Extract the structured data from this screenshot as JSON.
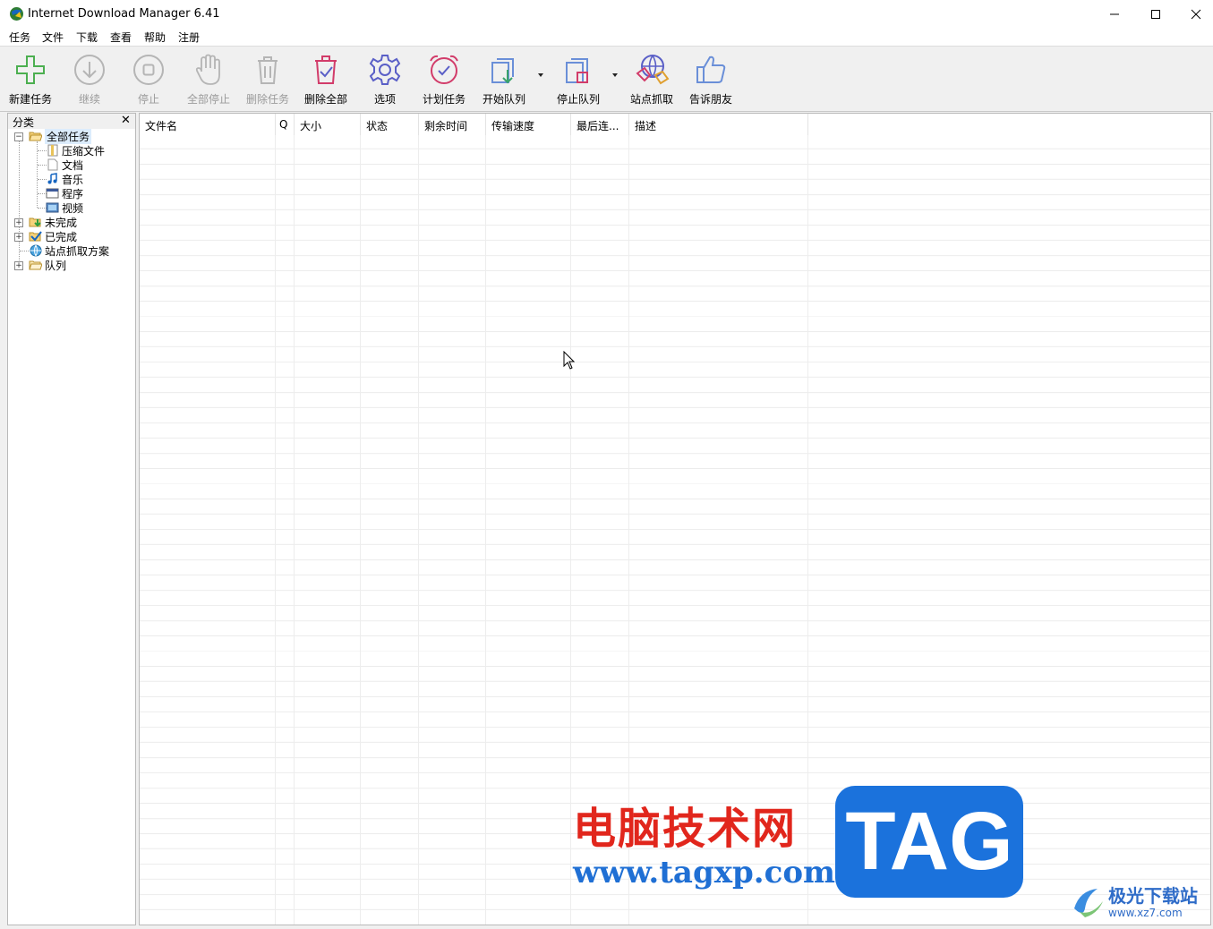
{
  "window": {
    "title": "Internet Download Manager 6.41"
  },
  "menu": [
    "任务",
    "文件",
    "下载",
    "查看",
    "帮助",
    "注册"
  ],
  "toolbar": {
    "new_task": "新建任务",
    "resume": "继续",
    "stop": "停止",
    "stop_all": "全部停止",
    "delete_task": "删除任务",
    "delete_all": "删除全部",
    "options": "选项",
    "scheduler": "计划任务",
    "start_queue": "开始队列",
    "stop_queue": "停止队列",
    "grabber": "站点抓取",
    "tell_friend": "告诉朋友"
  },
  "categories": {
    "title": "分类",
    "close": "✕",
    "all": "全部任务",
    "compressed": "压缩文件",
    "documents": "文档",
    "music": "音乐",
    "programs": "程序",
    "video": "视频",
    "unfinished": "未完成",
    "finished": "已完成",
    "grabber_projects": "站点抓取方案",
    "queues": "队列"
  },
  "columns": [
    "文件名",
    "Q",
    "大小",
    "状态",
    "剩余时间",
    "传输速度",
    "最后连...",
    "描述"
  ],
  "watermark": {
    "cn": "电脑技术网",
    "url": "www.tagxp.com",
    "tag": "TAG",
    "site2": "极光下载站",
    "site2_url": "www.xz7.com"
  },
  "colors": {
    "accent_purple": "#8b5ec9",
    "tree_selection": "#dcecfc",
    "watermark_red": "#e1261c",
    "watermark_blue": "#1b72dc"
  }
}
